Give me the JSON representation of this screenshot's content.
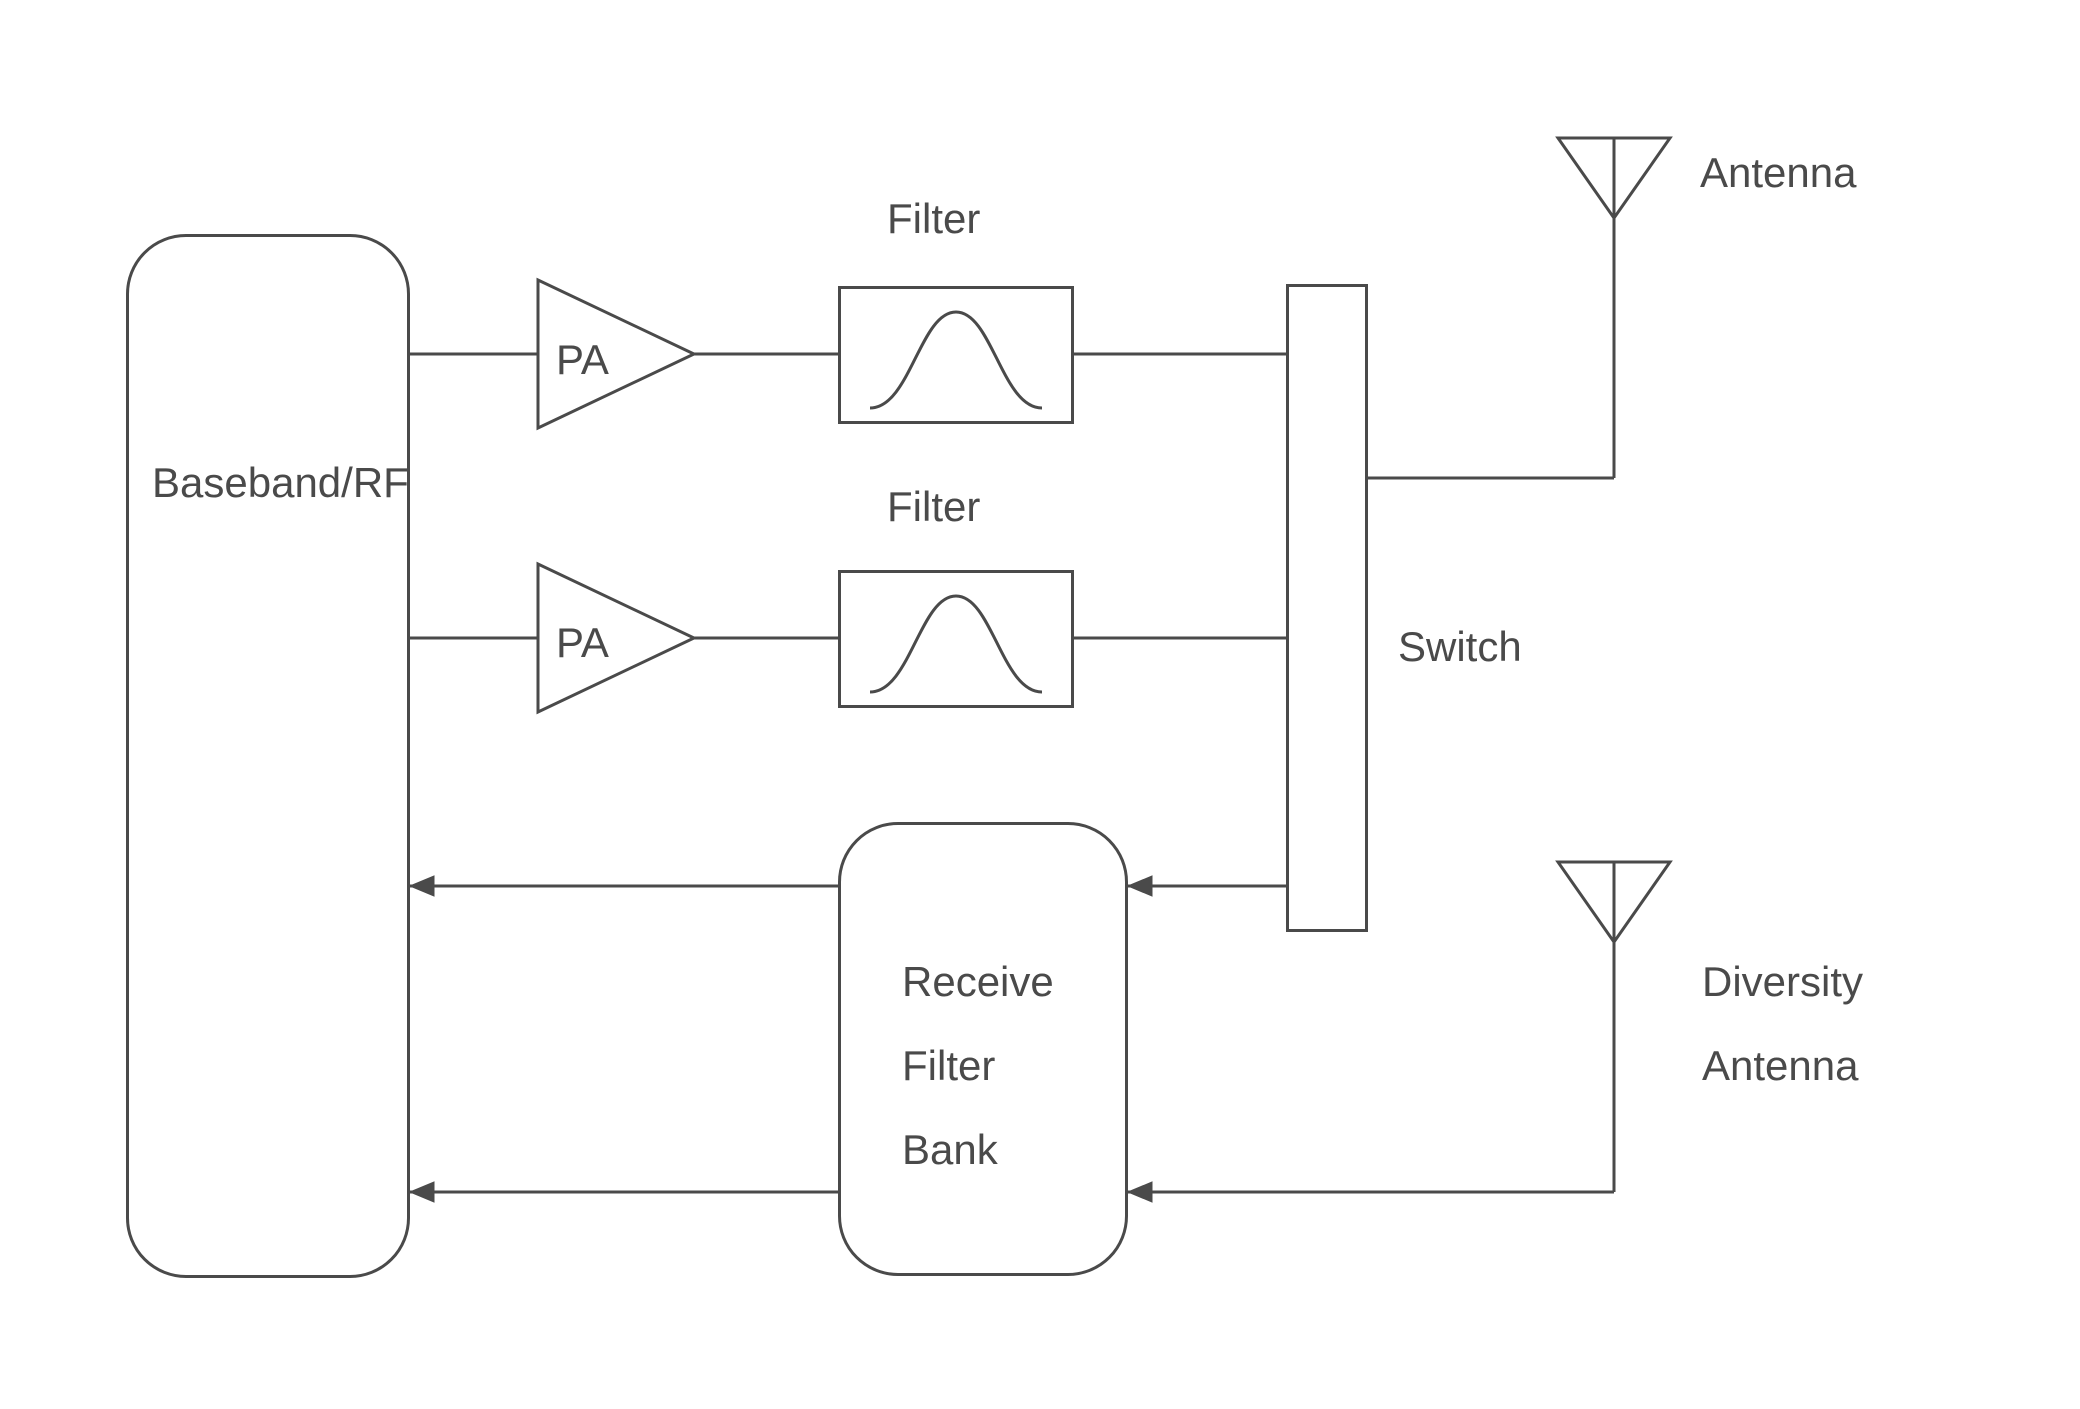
{
  "blocks": {
    "baseband_rf": "Baseband/RF",
    "pa1": "PA",
    "pa2": "PA",
    "filter1_caption": "Filter",
    "filter2_caption": "Filter",
    "switch": "Switch",
    "receive_filter_bank": "Receive\nFilter\nBank",
    "antenna": "Antenna",
    "diversity_antenna": "Diversity\nAntenna"
  }
}
